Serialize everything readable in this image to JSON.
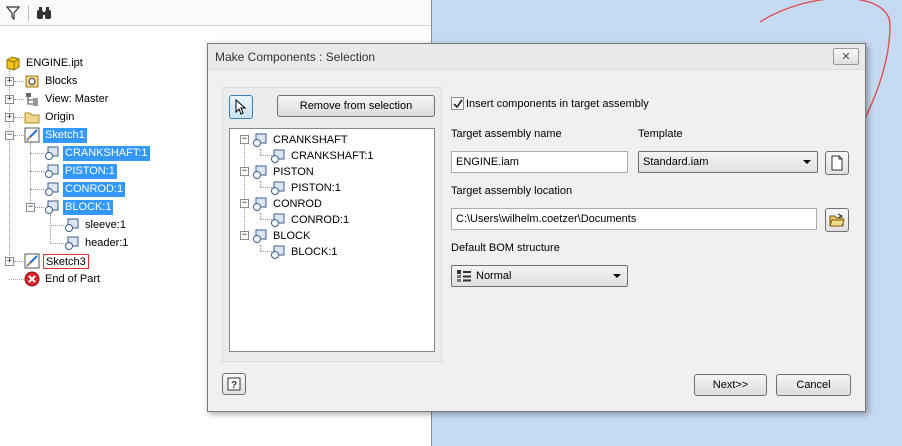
{
  "browser": {
    "tree": [
      {
        "label": "ENGINE.ipt",
        "icon": "part-icon"
      },
      {
        "label": "Blocks",
        "icon": "blocks-icon"
      },
      {
        "label": "View: Master",
        "icon": "view-icon"
      },
      {
        "label": "Origin",
        "icon": "folder-icon"
      },
      {
        "label": "Sketch1",
        "icon": "sketch-icon"
      },
      {
        "label": "CRANKSHAFT:1",
        "icon": "block-instance-icon"
      },
      {
        "label": "PISTON:1",
        "icon": "block-instance-icon"
      },
      {
        "label": "CONROD:1",
        "icon": "block-instance-icon"
      },
      {
        "label": "BLOCK:1",
        "icon": "block-instance-icon"
      },
      {
        "label": "sleeve:1",
        "icon": "block-instance-icon"
      },
      {
        "label": "header:1",
        "icon": "block-instance-icon"
      },
      {
        "label": "Sketch3",
        "icon": "sketch-icon"
      },
      {
        "label": "End of Part",
        "icon": "end-of-part-icon"
      }
    ]
  },
  "dialog": {
    "title": "Make Components : Selection",
    "remove_label": "Remove from selection",
    "selection_tree": [
      {
        "label": "CRANKSHAFT"
      },
      {
        "label": "CRANKSHAFT:1"
      },
      {
        "label": "PISTON"
      },
      {
        "label": "PISTON:1"
      },
      {
        "label": "CONROD"
      },
      {
        "label": "CONROD:1"
      },
      {
        "label": "BLOCK"
      },
      {
        "label": "BLOCK:1"
      }
    ],
    "insert_label": "Insert components in target assembly",
    "insert_checked": true,
    "target_name_label": "Target assembly name",
    "target_name_value": "ENGINE.iam",
    "template_label": "Template",
    "template_value": "Standard.iam",
    "location_label": "Target assembly location",
    "location_value": "C:\\Users\\wilhelm.coetzer\\Documents",
    "bom_label": "Default BOM structure",
    "bom_value": "Normal",
    "next_label": "Next>>",
    "cancel_label": "Cancel"
  },
  "colors": {
    "selection": "#3399ff",
    "viewport": "#c6daf1",
    "highlight_border": "#e03030"
  }
}
